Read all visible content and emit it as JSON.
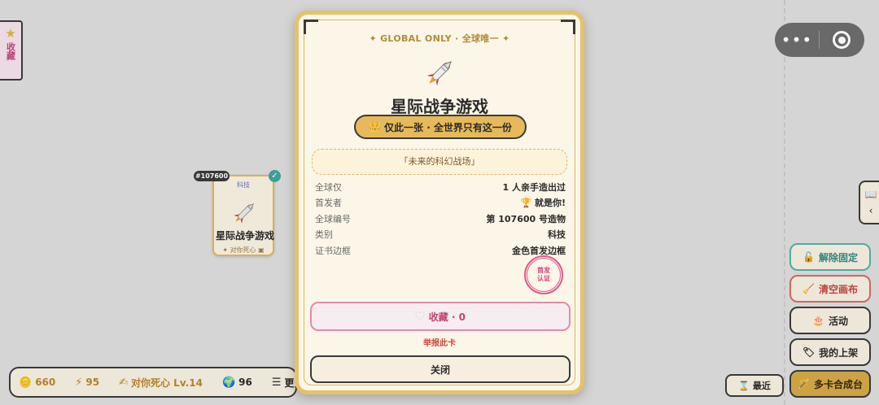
{
  "sidebar_left": {
    "star_icon": "star-icon",
    "label": "收藏"
  },
  "canvas_card": {
    "id_tag": "#107600",
    "category": "科技",
    "name": "星际战争游戏",
    "owner": "对你死心"
  },
  "stats": {
    "coins": "660",
    "energy": "95",
    "user": "对你死心 Lv.14",
    "globe": "96",
    "more": "更多"
  },
  "capsule": {
    "more": "•••"
  },
  "right_buttons": {
    "unpin": "解除固定",
    "clear": "清空画布",
    "activity": "活动",
    "listings": "我的上架",
    "merge": "多卡合成台",
    "recent": "最近"
  },
  "modal": {
    "global_label": "✦ GLOBAL ONLY · 全球唯一 ✦",
    "title": "星际战争游戏",
    "unique_badge": "仅此一张 · 全世界只有这一份",
    "tagline": "「未来的科幻战场」",
    "info": [
      {
        "key": "全球仅",
        "value": "1 人亲手造出过"
      },
      {
        "key": "首发者",
        "value": "🏆 就是你!"
      },
      {
        "key": "全球编号",
        "value": "第 107600 号造物"
      },
      {
        "key": "类别",
        "value": "科技"
      },
      {
        "key": "证书边框",
        "value": "金色首发边框"
      }
    ],
    "stamp_line1": "首发",
    "stamp_line2": "认证",
    "collect_label": "收藏 · 0",
    "report": "举报此卡",
    "close": "关闭"
  },
  "colors": {
    "gold": "#e7c16a",
    "pink": "#e58aa8",
    "teal": "#55b0a8",
    "red": "#d66a63"
  }
}
